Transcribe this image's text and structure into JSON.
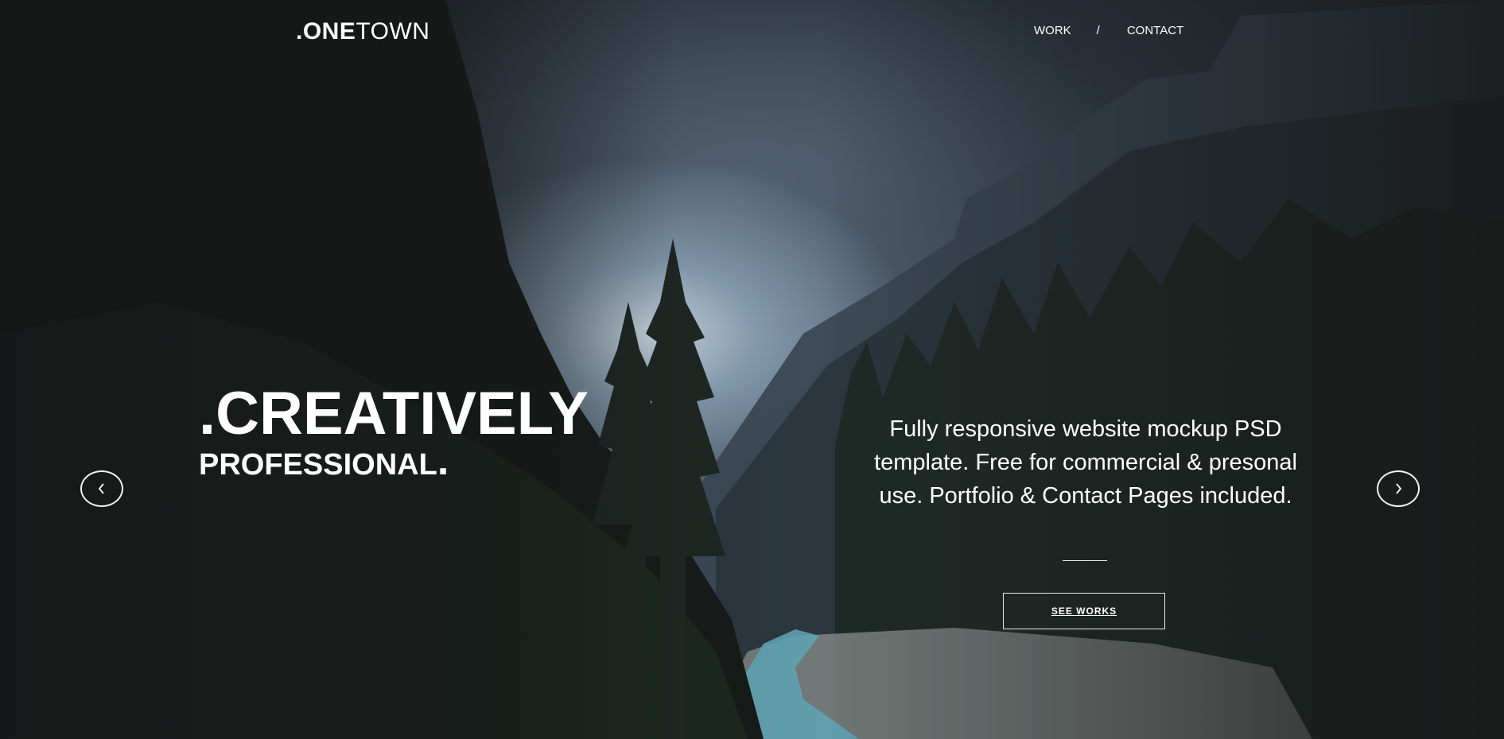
{
  "header": {
    "logo_prefix": ".ONE",
    "logo_suffix": "TOWN",
    "nav": [
      {
        "label": "WORK"
      },
      {
        "label": "/"
      },
      {
        "label": "CONTACT"
      }
    ]
  },
  "hero": {
    "headline_main": ".CREATIVELY",
    "headline_sub": "PROFESSIONAL",
    "headline_sub_dot": ".",
    "description": "Fully responsive website mockup PSD template. Free for commercial & presonal use. Portfolio & Contact Pages included.",
    "cta_label": "SEE WORKS"
  },
  "icons": {
    "prev": "chevron-left-icon",
    "next": "chevron-right-icon"
  },
  "colors": {
    "text": "#ffffff",
    "background": "#1c1d1f"
  }
}
